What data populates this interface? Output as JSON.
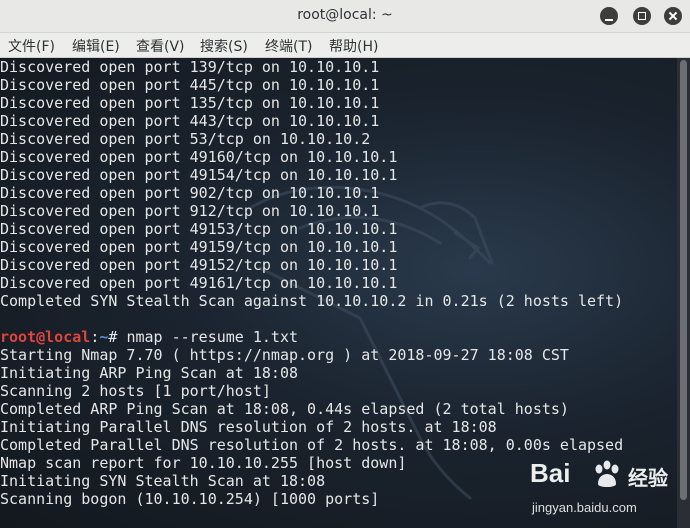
{
  "window": {
    "title": "root@local: ~"
  },
  "menu": [
    "文件(F)",
    "编辑(E)",
    "查看(V)",
    "搜索(S)",
    "终端(T)",
    "帮助(H)"
  ],
  "terminal": {
    "lines": [
      "Discovered open port 139/tcp on 10.10.10.1",
      "Discovered open port 445/tcp on 10.10.10.1",
      "Discovered open port 135/tcp on 10.10.10.1",
      "Discovered open port 443/tcp on 10.10.10.1",
      "Discovered open port 53/tcp on 10.10.10.2",
      "Discovered open port 49160/tcp on 10.10.10.1",
      "Discovered open port 49154/tcp on 10.10.10.1",
      "Discovered open port 902/tcp on 10.10.10.1",
      "Discovered open port 912/tcp on 10.10.10.1",
      "Discovered open port 49153/tcp on 10.10.10.1",
      "Discovered open port 49159/tcp on 10.10.10.1",
      "Discovered open port 49152/tcp on 10.10.10.1",
      "Discovered open port 49161/tcp on 10.10.10.1",
      "Completed SYN Stealth Scan against 10.10.10.2 in 0.21s (2 hosts left)",
      "",
      "Starting Nmap 7.70 ( https://nmap.org ) at 2018-09-27 18:08 CST",
      "Initiating ARP Ping Scan at 18:08",
      "Scanning 2 hosts [1 port/host]",
      "Completed ARP Ping Scan at 18:08, 0.44s elapsed (2 total hosts)",
      "Initiating Parallel DNS resolution of 2 hosts. at 18:08",
      "Completed Parallel DNS resolution of 2 hosts. at 18:08, 0.00s elapsed",
      "Nmap scan report for 10.10.10.255 [host down]",
      "Initiating SYN Stealth Scan at 18:08",
      "Scanning bogon (10.10.10.254) [1000 ports]"
    ],
    "prompt": {
      "user": "root@local",
      "sep": ":",
      "path": "~",
      "symbol": "# ",
      "command": "nmap --resume 1.txt",
      "insert_after_line": 14
    }
  },
  "watermark": {
    "brand": "Bai",
    "brand_cn": "经验",
    "url": "jingyan.baidu.com"
  },
  "colors": {
    "prompt_user": "#e0443e",
    "prompt_path": "#5a8fd6",
    "text": "#e6e6e6"
  }
}
